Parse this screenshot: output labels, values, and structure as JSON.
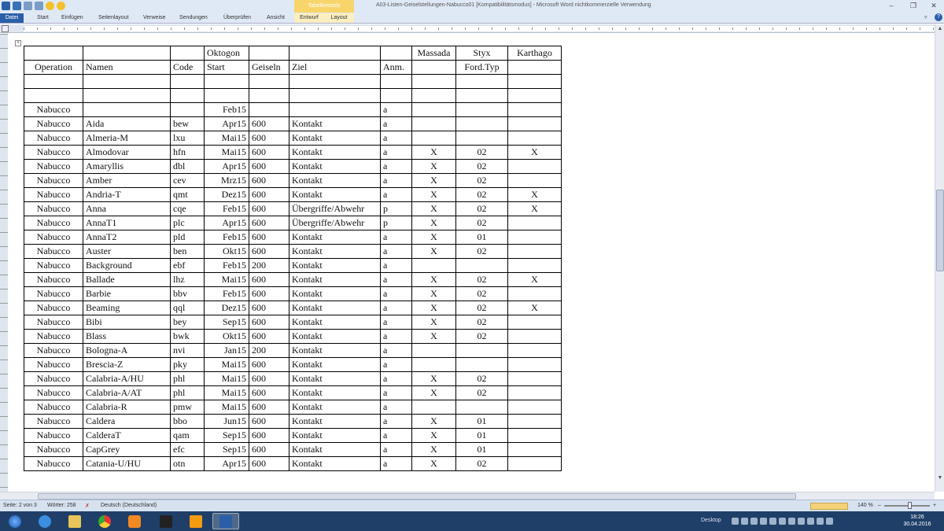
{
  "window": {
    "title": "A03-Listen-Geiselstellungen-Nabucco01 [Kompatibilitätsmodus] - Microsoft Word nichtkommerzielle Verwendung",
    "context_tool": "Tabellentools"
  },
  "ribbon_tabs": [
    "Datei",
    "Start",
    "Einfügen",
    "Seitenlayout",
    "Verweise",
    "Sendungen",
    "Überprüfen",
    "Ansicht",
    "Entwurf",
    "Layout"
  ],
  "table": {
    "header_top": [
      "",
      "",
      "",
      "Oktogon",
      "",
      "",
      "",
      "Massada",
      "Styx",
      "Karthago"
    ],
    "header_bottom": [
      "Operation",
      "Namen",
      "Code",
      "Start",
      "Geiseln",
      "Ziel",
      "Anm.",
      "",
      "Ford.Typ",
      ""
    ],
    "rows": [
      [
        "",
        "",
        "",
        "",
        "",
        "",
        "",
        "",
        "",
        ""
      ],
      [
        "",
        "",
        "",
        "",
        "",
        "",
        "",
        "",
        "",
        ""
      ],
      [
        "Nabucco",
        "",
        "",
        "Feb15",
        "",
        "",
        "a",
        "",
        "",
        ""
      ],
      [
        "Nabucco",
        "Aida",
        "bew",
        "Apr15",
        "600",
        "Kontakt",
        "a",
        "",
        "",
        ""
      ],
      [
        "Nabucco",
        "Almeria-M",
        "lxu",
        "Mai15",
        "600",
        "Kontakt",
        "a",
        "",
        "",
        ""
      ],
      [
        "Nabucco",
        "Almodovar",
        "hfn",
        "Mai15",
        "600",
        "Kontakt",
        "a",
        "X",
        "02",
        "X"
      ],
      [
        "Nabucco",
        "Amaryllis",
        "dbl",
        "Apr15",
        "600",
        "Kontakt",
        "a",
        "X",
        "02",
        ""
      ],
      [
        "Nabucco",
        "Amber",
        "cev",
        "Mrz15",
        "600",
        "Kontakt",
        "a",
        "X",
        "02",
        ""
      ],
      [
        "Nabucco",
        "Andria-T",
        "qmt",
        "Dez15",
        "600",
        "Kontakt",
        "a",
        "X",
        "02",
        "X"
      ],
      [
        "Nabucco",
        "Anna",
        "cqe",
        "Feb15",
        "600",
        "Übergriffe/Abwehr",
        "p",
        "X",
        "02",
        "X"
      ],
      [
        "Nabucco",
        "AnnaT1",
        "plc",
        "Apr15",
        "600",
        "Übergriffe/Abwehr",
        "p",
        "X",
        "02",
        ""
      ],
      [
        "Nabucco",
        "AnnaT2",
        "pld",
        "Feb15",
        "600",
        "Kontakt",
        "a",
        "X",
        "01",
        ""
      ],
      [
        "Nabucco",
        "Auster",
        "ben",
        "Okt15",
        "600",
        "Kontakt",
        "a",
        "X",
        "02",
        ""
      ],
      [
        "Nabucco",
        "Background",
        "ebf",
        "Feb15",
        "200",
        "Kontakt",
        "a",
        "",
        "",
        ""
      ],
      [
        "Nabucco",
        "Ballade",
        "lhz",
        "Mai15",
        "600",
        "Kontakt",
        "a",
        "X",
        "02",
        "X"
      ],
      [
        "Nabucco",
        "Barbie",
        "bbv",
        "Feb15",
        "600",
        "Kontakt",
        "a",
        "X",
        "02",
        ""
      ],
      [
        "Nabucco",
        "Beaming",
        "qql",
        "Dez15",
        "600",
        "Kontakt",
        "a",
        "X",
        "02",
        "X"
      ],
      [
        "Nabucco",
        "Bibi",
        "bey",
        "Sep15",
        "600",
        "Kontakt",
        "a",
        "X",
        "02",
        ""
      ],
      [
        "Nabucco",
        "Blass",
        "bwk",
        "Okt15",
        "600",
        "Kontakt",
        "a",
        "X",
        "02",
        ""
      ],
      [
        "Nabucco",
        "Bologna-A",
        "nvi",
        "Jan15",
        "200",
        "Kontakt",
        "a",
        "",
        "",
        ""
      ],
      [
        "Nabucco",
        "Brescia-Z",
        "pky",
        "Mai15",
        "600",
        "Kontakt",
        "a",
        "",
        "",
        ""
      ],
      [
        "Nabucco",
        "Calabria-A/HU",
        "phl",
        "Mai15",
        "600",
        "Kontakt",
        "a",
        "X",
        "02",
        ""
      ],
      [
        "Nabucco",
        "Calabria-A/AT",
        "phl",
        "Mai15",
        "600",
        "Kontakt",
        "a",
        "X",
        "02",
        ""
      ],
      [
        "Nabucco",
        "Calabria-R",
        "pmw",
        "Mai15",
        "600",
        "Kontakt",
        "a",
        "",
        "",
        ""
      ],
      [
        "Nabucco",
        "Caldera",
        "bbo",
        "Jun15",
        "600",
        "Kontakt",
        "a",
        "X",
        "01",
        ""
      ],
      [
        "Nabucco",
        "CalderaT",
        "qam",
        "Sep15",
        "600",
        "Kontakt",
        "a",
        "X",
        "01",
        ""
      ],
      [
        "Nabucco",
        "CapGrey",
        "efc",
        "Sep15",
        "600",
        "Kontakt",
        "a",
        "X",
        "01",
        ""
      ],
      [
        "Nabucco",
        "Catania-U/HU",
        "otn",
        "Apr15",
        "600",
        "Kontakt",
        "a",
        "X",
        "02",
        ""
      ]
    ]
  },
  "status": {
    "page": "Seite: 2 von 3",
    "words": "Wörter: 258",
    "language": "Deutsch (Deutschland)",
    "zoom": "140 %"
  },
  "taskbar": {
    "desktop_label": "Desktop",
    "time": "18:26",
    "date": "30.04.2016"
  }
}
